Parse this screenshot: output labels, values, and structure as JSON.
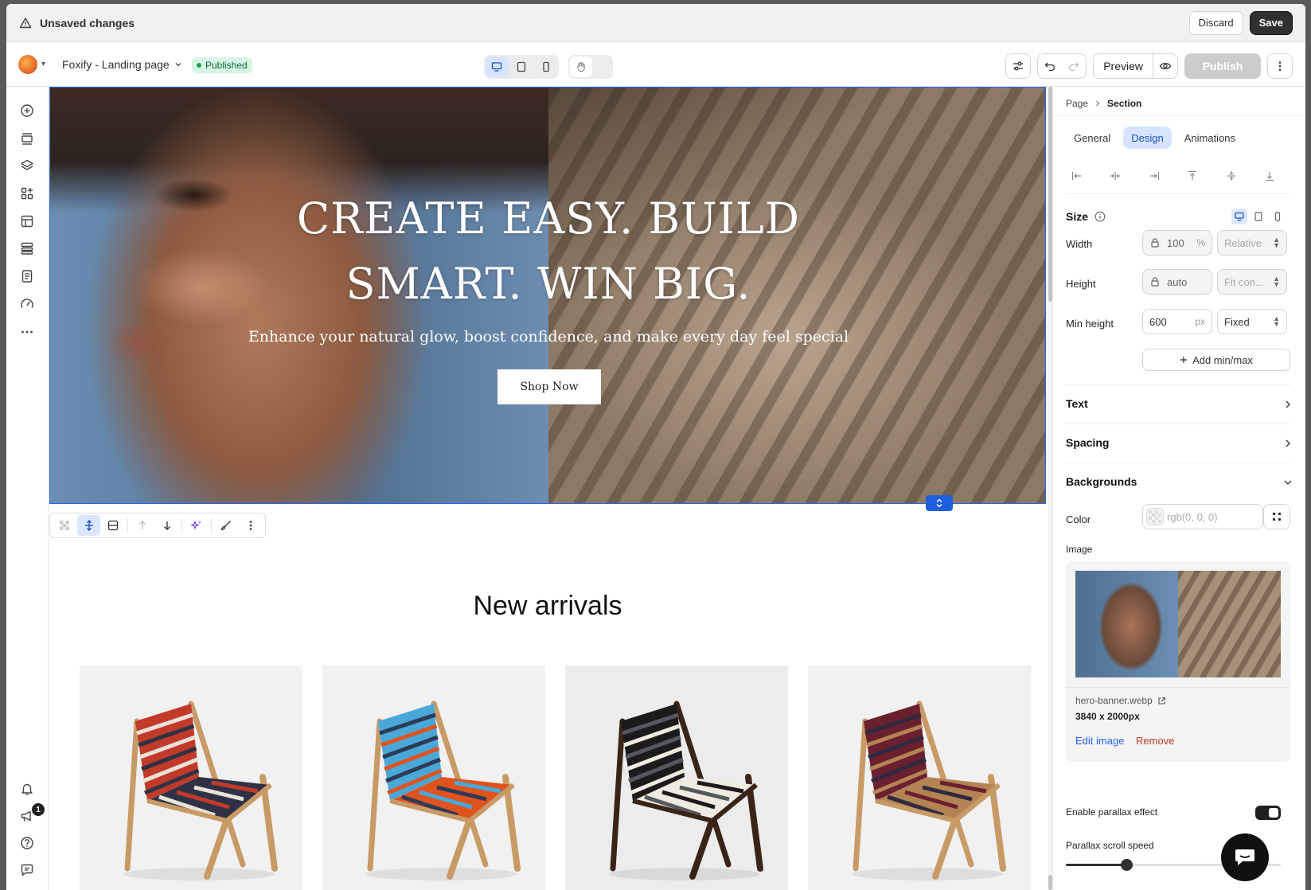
{
  "unsaved_bar": {
    "title": "Unsaved changes",
    "discard": "Discard",
    "save": "Save"
  },
  "topbar": {
    "page_name": "Foxify - Landing page",
    "status": "Published",
    "preview": "Preview",
    "publish": "Publish"
  },
  "hero": {
    "heading_line1": "CREATE EASY. BUILD",
    "heading_line2": "SMART. WIN BIG.",
    "subtitle": "Enhance your natural glow, boost confidence, and make every day feel special",
    "cta": "Shop Now"
  },
  "new_arrivals": {
    "heading": "New arrivals"
  },
  "products": [
    {
      "colors": [
        "#c23a2a",
        "#2e3244",
        "#e8e2d8"
      ]
    },
    {
      "colors": [
        "#4aa8d8",
        "#e0531f",
        "#2d3a58"
      ]
    },
    {
      "colors": [
        "#1b1b1b",
        "#f0ebe0",
        "#55585e"
      ]
    },
    {
      "colors": [
        "#6b2030",
        "#b38453",
        "#2f2a40"
      ]
    }
  ],
  "panel": {
    "breadcrumb_page": "Page",
    "breadcrumb_section": "Section",
    "tabs": {
      "general": "General",
      "design": "Design",
      "animations": "Animations"
    },
    "size": {
      "label": "Size",
      "width_label": "Width",
      "width_value": "100",
      "width_unit": "%",
      "width_mode": "Relative",
      "height_label": "Height",
      "height_value": "auto",
      "height_mode": "Fit con...",
      "minheight_label": "Min height",
      "minheight_value": "600",
      "minheight_unit": "px",
      "minheight_mode": "Fixed",
      "add_minmax": "Add min/max"
    },
    "sections": {
      "text": "Text",
      "spacing": "Spacing",
      "backgrounds": "Backgrounds"
    },
    "backgrounds": {
      "color_label": "Color",
      "color_placeholder": "rgb(0, 0, 0)",
      "image_label": "Image",
      "file_name": "hero-banner.webp",
      "dimensions": "3840 x 2000px",
      "edit_image": "Edit image",
      "remove": "Remove",
      "parallax_label": "Enable parallax effect",
      "parallax_enabled": true,
      "parallax_speed_label": "Parallax scroll speed",
      "parallax_speed_fraction": 0.28
    }
  },
  "notifications": {
    "badge_count": "1"
  },
  "colors": {
    "accent": "#2463eb",
    "remove": "#c0391e",
    "published_bg": "#d7f5e2"
  }
}
